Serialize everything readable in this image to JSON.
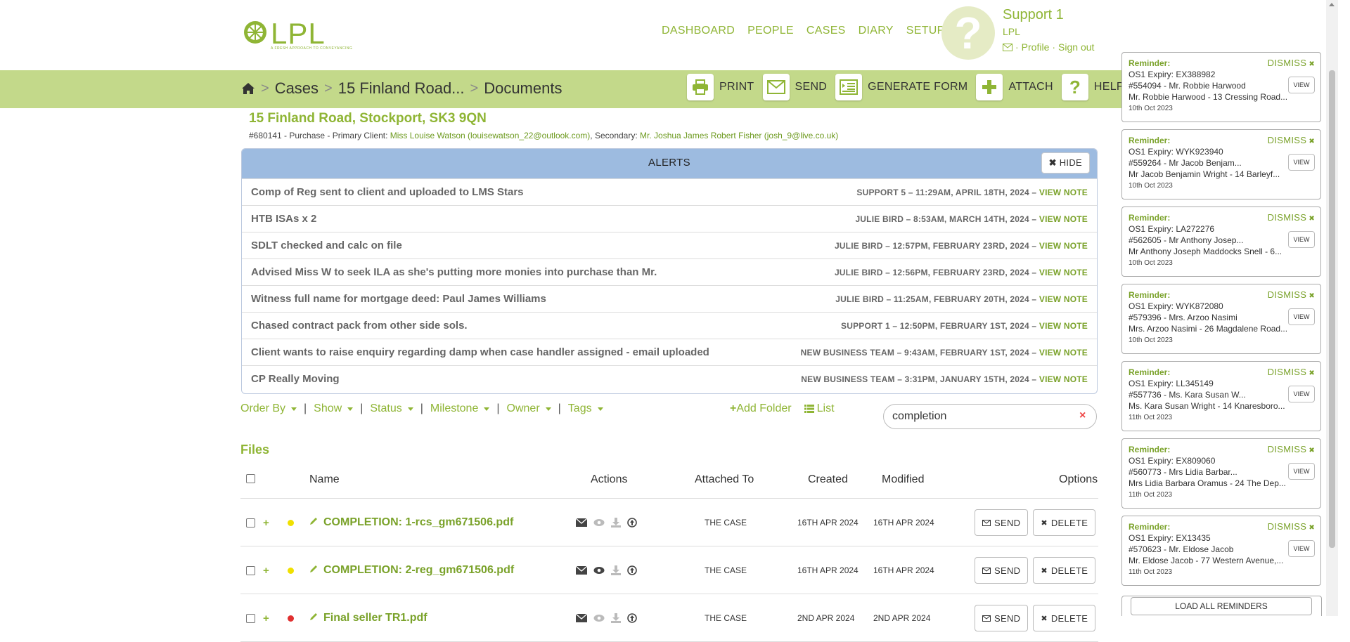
{
  "header": {
    "logo_text": "LPL",
    "logo_tagline": "A FRESH APPROACH TO CONVEYANCING",
    "nav": [
      "DASHBOARD",
      "PEOPLE",
      "CASES",
      "DIARY",
      "SETUP"
    ],
    "avatar_glyph": "?",
    "user_name": "Support 1",
    "user_org": "LPL",
    "profile_link": "Profile",
    "signout_link": "Sign out",
    "link_separator": "·"
  },
  "breadcrumb": {
    "items": [
      "Cases",
      "15 Finland Road...",
      "Documents"
    ],
    "separator": ">"
  },
  "toolbar": {
    "print": "PRINT",
    "send": "SEND",
    "generate_form": "GENERATE FORM",
    "attach": "ATTACH",
    "help": "HELP"
  },
  "case": {
    "title": "15 Finland Road, Stockport, SK3 9QN",
    "meta_prefix": "#680141 - Purchase - Primary Client: ",
    "primary_client": "Miss Louise Watson (louisewatson_22@outlook.com)",
    "meta_mid": ", Secondary: ",
    "secondary_client": "Mr. Joshua James Robert Fisher (josh_9@live.co.uk)"
  },
  "alerts": {
    "title": "ALERTS",
    "hide_label": "HIDE",
    "view_note_label": "VIEW NOTE",
    "rows": [
      {
        "text": "Comp of Reg sent to client and uploaded to LMS Stars",
        "meta": "SUPPORT 5 – 11:29AM, APRIL 18TH, 2024 –"
      },
      {
        "text": "HTB ISAs x 2",
        "meta": "JULIE BIRD – 8:53AM, MARCH 14TH, 2024 –"
      },
      {
        "text": "SDLT checked and calc on file",
        "meta": "JULIE BIRD – 12:57PM, FEBRUARY 23RD, 2024 –"
      },
      {
        "text": "Advised Miss W to seek ILA as she's putting more monies into purchase than Mr.",
        "meta": "JULIE BIRD – 12:56PM, FEBRUARY 23RD, 2024 –"
      },
      {
        "text": "Witness full name for mortgage deed: Paul James Williams",
        "meta": "JULIE BIRD – 11:25AM, FEBRUARY 20TH, 2024 –"
      },
      {
        "text": "Chased contract pack from other side sols.",
        "meta": "SUPPORT 1 – 12:50PM, FEBRUARY 1ST, 2024 –"
      },
      {
        "text": "Client wants to raise enquiry regarding damp when case handler assigned - email uploaded",
        "meta": "NEW BUSINESS TEAM – 9:43AM, FEBRUARY 1ST, 2024 –"
      },
      {
        "text": "CP Really Moving",
        "meta": "NEW BUSINESS TEAM – 3:31PM, JANUARY 15TH, 2024 –"
      }
    ]
  },
  "filters": {
    "order_by": "Order By",
    "show": "Show",
    "status": "Status",
    "milestone": "Milestone",
    "owner": "Owner",
    "tags": "Tags",
    "pipe": "|",
    "add_folder": "Add Folder",
    "list": "List",
    "search_value": "completion",
    "search_clear": "×"
  },
  "files": {
    "title": "Files",
    "headers": {
      "name": "Name",
      "actions": "Actions",
      "attached_to": "Attached To",
      "created": "Created",
      "modified": "Modified",
      "options": "Options"
    },
    "send_label": "SEND",
    "delete_label": "DELETE",
    "rows": [
      {
        "name": "COMPLETION: 1-rcs_gm671506.pdf",
        "attached": "THE CASE",
        "created": "16TH APR 2024",
        "modified": "16TH APR 2024",
        "status_color": "#f0e000"
      },
      {
        "name": "COMPLETION: 2-reg_gm671506.pdf",
        "attached": "THE CASE",
        "created": "16TH APR 2024",
        "modified": "16TH APR 2024",
        "status_color": "#f0e000"
      },
      {
        "name": "Final seller TR1.pdf",
        "attached": "THE CASE",
        "created": "2ND APR 2024",
        "modified": "2ND APR 2024",
        "status_color": "#e03030"
      }
    ]
  },
  "reminders": {
    "label": "Reminder:",
    "dismiss": "DISMISS",
    "view": "VIEW",
    "load_all": "LOAD ALL REMINDERS",
    "items": [
      {
        "line1": "OS1 Expiry: EX388982",
        "line2": "#554094 - Mr. Robbie Harwood",
        "line3": "Mr. Robbie Harwood - 13 Cressing Road...",
        "date": "10th Oct 2023"
      },
      {
        "line1": "OS1 Expiry: WYK923940",
        "line2": "#559264 - Mr Jacob Benjam...",
        "line3": "Mr Jacob Benjamin Wright - 14 Barleyf...",
        "date": "10th Oct 2023"
      },
      {
        "line1": "OS1 Expiry: LA272276",
        "line2": "#562605 - Mr Anthony Josep...",
        "line3": "Mr Anthony Joseph Maddocks Snell - 6...",
        "date": "10th Oct 2023"
      },
      {
        "line1": "OS1 Expiry: WYK872080",
        "line2": "#579396 - Mrs. Arzoo Nasimi",
        "line3": "Mrs. Arzoo Nasimi - 26 Magdalene Road...",
        "date": "10th Oct 2023"
      },
      {
        "line1": "OS1 Expiry: LL345149",
        "line2": "#557736 - Ms. Kara Susan W...",
        "line3": "Ms. Kara Susan Wright - 14 Knaresboro...",
        "date": "11th Oct 2023"
      },
      {
        "line1": "OS1 Expiry: EX809060",
        "line2": "#560773 - Mrs Lidia Barbar...",
        "line3": "Mrs Lidia Barbara Oramus - 24 The Dep...",
        "date": "11th Oct 2023"
      },
      {
        "line1": "OS1 Expiry: EX13435",
        "line2": "#570623 - Mr. Eldose Jacob",
        "line3": "Mr. Eldose Jacob - 77 Western Avenue,...",
        "date": "11th Oct 2023"
      }
    ]
  }
}
